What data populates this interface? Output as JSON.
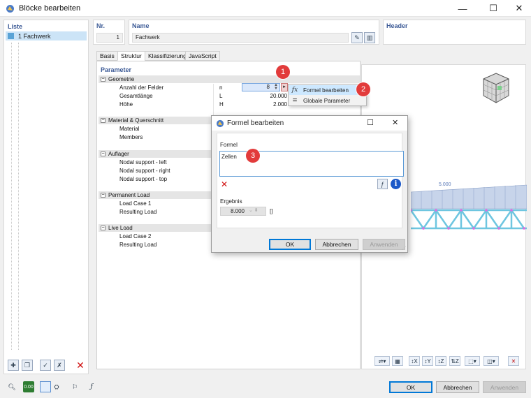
{
  "window": {
    "title": "Blöcke bearbeiten",
    "minimize_glyph": "—",
    "maximize_glyph": "☐",
    "close_glyph": "✕"
  },
  "list": {
    "title": "Liste",
    "items": [
      {
        "label": "1 Fachwerk",
        "selected": true
      }
    ],
    "toolbar_icons": [
      "new-block-icon",
      "copy-block-icon",
      "check-icon",
      "uncheck-icon",
      "delete-icon"
    ]
  },
  "header_fields": {
    "nr_label": "Nr.",
    "nr_value": "1",
    "name_label": "Name",
    "name_value": "Fachwerk",
    "header_label": "Header"
  },
  "tabs": [
    {
      "label": "Basis",
      "active": false
    },
    {
      "label": "Struktur",
      "active": true
    },
    {
      "label": "Klassifizierung",
      "active": false
    },
    {
      "label": "JavaScript",
      "active": false
    }
  ],
  "parameters": {
    "title": "Parameter",
    "groups": [
      {
        "name": "Geometrie",
        "toggle": "−",
        "rows": [
          {
            "label": "Anzahl der Felder",
            "symbol": "n",
            "value": "8"
          },
          {
            "label": "Gesamtlänge",
            "symbol": "L",
            "value": "20.000"
          },
          {
            "label": "Höhe",
            "symbol": "H",
            "value": "2.000"
          }
        ]
      },
      {
        "name": "Material & Querschnitt",
        "toggle": "−",
        "rows": [
          {
            "label": "Material"
          },
          {
            "label": "Members"
          }
        ]
      },
      {
        "name": "Auflager",
        "toggle": "−",
        "rows": [
          {
            "label": "Nodal support - left"
          },
          {
            "label": "Nodal support - right"
          },
          {
            "label": "Nodal support - top"
          }
        ]
      },
      {
        "name": "Permanent Load",
        "toggle": "−",
        "rows": [
          {
            "label": "Load Case 1"
          },
          {
            "label": "Resulting Load"
          }
        ]
      },
      {
        "name": "Live Load",
        "toggle": "−",
        "rows": [
          {
            "label": "Load Case 2"
          },
          {
            "label": "Resulting Load"
          }
        ]
      }
    ]
  },
  "context_menu": {
    "items": [
      {
        "icon": "fx-icon",
        "glyph": "fx",
        "label": "Formel bearbeiten",
        "highlighted": true
      },
      {
        "icon": "global-params-icon",
        "glyph": "≡",
        "label": "Globale Parameter",
        "highlighted": false
      }
    ]
  },
  "badges": [
    "1",
    "2",
    "3"
  ],
  "formula_dialog": {
    "title": "Formel bearbeiten",
    "formula_label": "Formel",
    "formula_text": "Zellen",
    "result_label": "Ergebnis",
    "result_value": "8.000",
    "result_unit": "[]",
    "ok": "OK",
    "cancel": "Abbrechen",
    "apply": "Anwenden"
  },
  "preview": {
    "load_label": "5.000",
    "colors": {
      "truss": "#6ec6e0",
      "load": "#c7d4ea",
      "node": "#e06be0"
    }
  },
  "footer": {
    "ok": "OK",
    "cancel": "Abbrechen",
    "apply": "Anwenden",
    "value_badge": "0.00"
  }
}
